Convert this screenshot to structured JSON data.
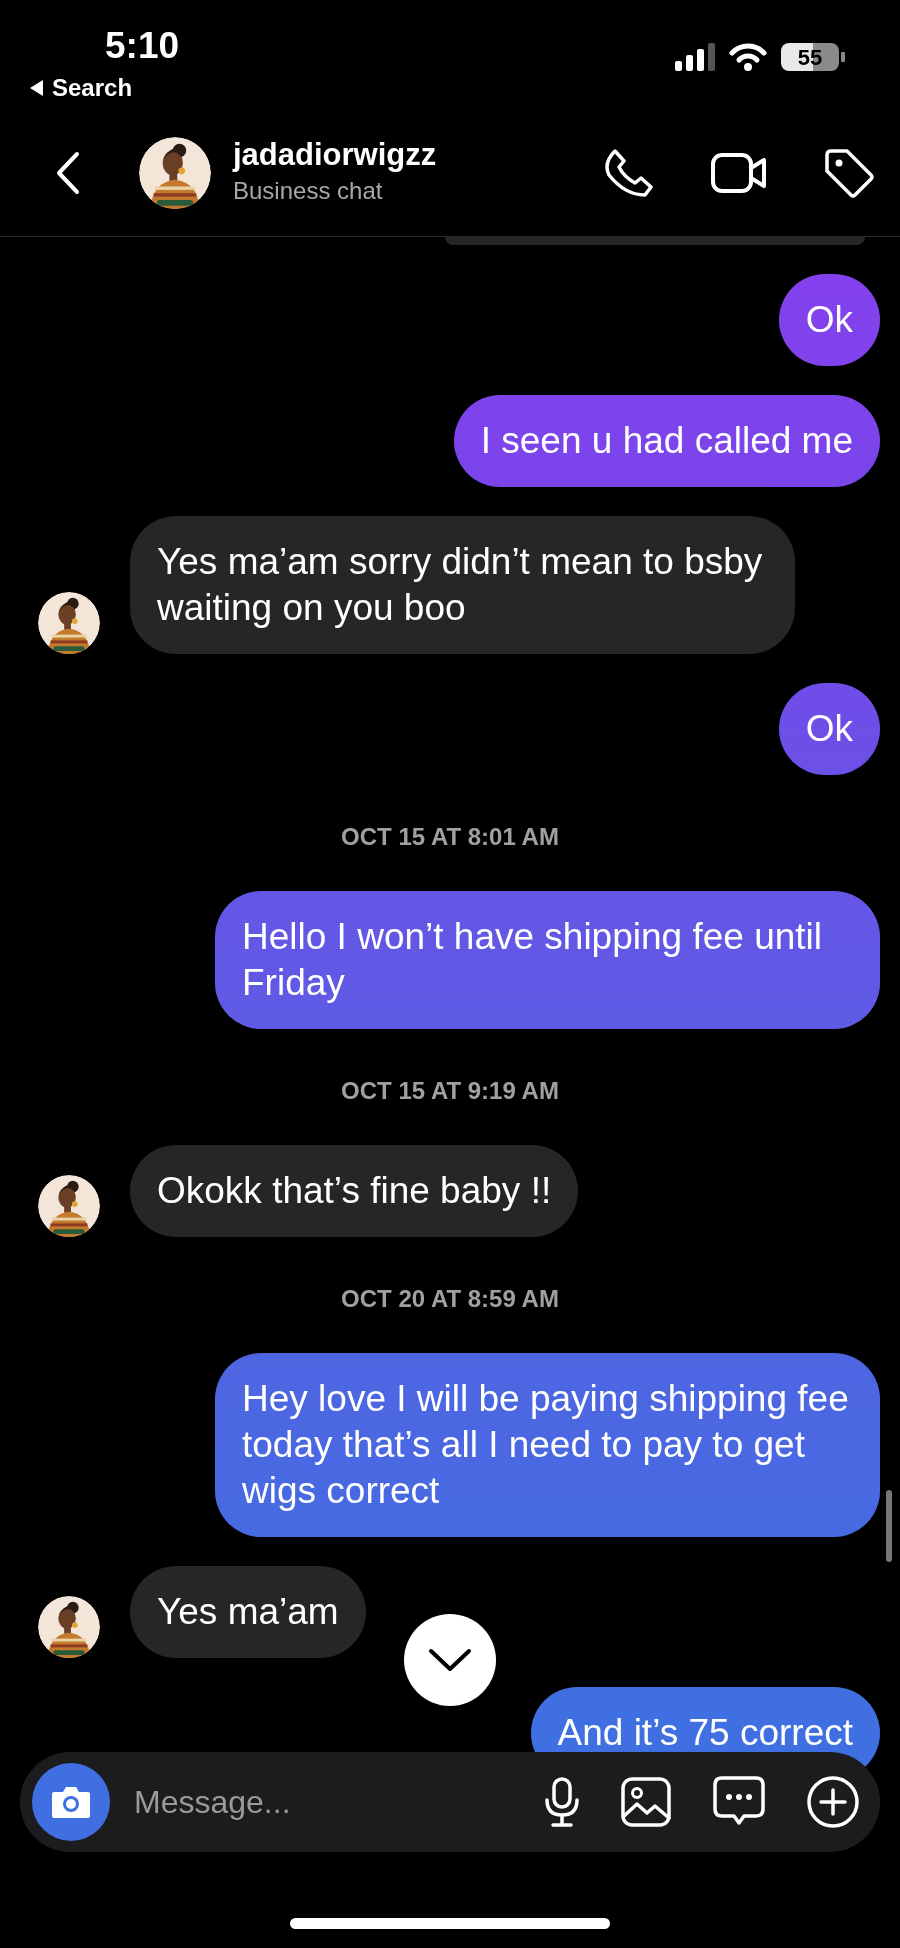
{
  "status_bar": {
    "time": "5:10",
    "back_label": "Search",
    "battery": "55"
  },
  "header": {
    "name": "jadadiorwigzz",
    "subtitle": "Business chat"
  },
  "messages": [
    {
      "kind": "edge"
    },
    {
      "kind": "sent",
      "text": "Ok"
    },
    {
      "kind": "sent",
      "text": "I seen u had called me"
    },
    {
      "kind": "received",
      "text": "Yes ma’am sorry didn’t mean to bsby waiting on you boo"
    },
    {
      "kind": "sent",
      "text": "Ok"
    },
    {
      "kind": "time",
      "text": "OCT 15 AT 8:01 AM"
    },
    {
      "kind": "sent",
      "text": "Hello I won’t have shipping fee until Friday"
    },
    {
      "kind": "time",
      "text": "OCT 15 AT 9:19 AM"
    },
    {
      "kind": "received",
      "text": "Okokk that’s fine baby !!"
    },
    {
      "kind": "time",
      "text": "OCT 20 AT 8:59 AM"
    },
    {
      "kind": "sent",
      "text": "Hey love I will be paying shipping fee today that’s all I need to pay to get wigs correct"
    },
    {
      "kind": "received",
      "text": "Yes ma’am"
    },
    {
      "kind": "sent",
      "text": "And it’s 75 correct"
    }
  ],
  "composer": {
    "placeholder": "Message..."
  }
}
